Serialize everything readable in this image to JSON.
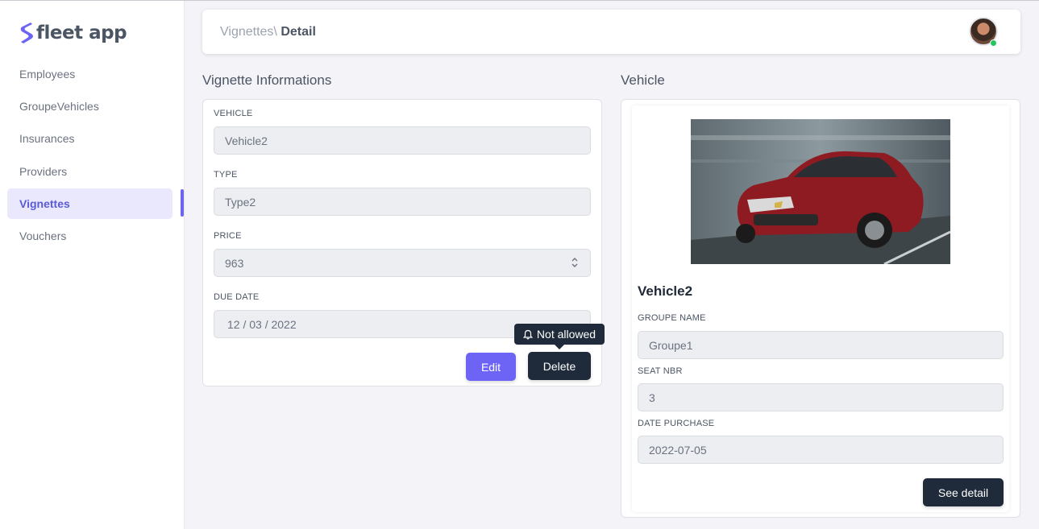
{
  "app": {
    "name": "fleet app"
  },
  "sidebar": {
    "items": [
      {
        "label": "Employees",
        "active": false
      },
      {
        "label": "GroupeVehicles",
        "active": false
      },
      {
        "label": "Insurances",
        "active": false
      },
      {
        "label": "Providers",
        "active": false
      },
      {
        "label": "Vignettes",
        "active": true
      },
      {
        "label": "Vouchers",
        "active": false
      }
    ]
  },
  "header": {
    "breadcrumb_parent": "Vignettes\\",
    "breadcrumb_current": "Detail"
  },
  "vignette": {
    "section_title": "Vignette Informations",
    "fields": {
      "vehicle": {
        "label": "VEHICLE",
        "value": "Vehicle2"
      },
      "type": {
        "label": "TYPE",
        "value": "Type2"
      },
      "price": {
        "label": "PRICE",
        "value": "963"
      },
      "due_date": {
        "label": "DUE DATE",
        "value": "12 / 03 / 2022"
      }
    },
    "edit_label": "Edit",
    "delete_label": "Delete",
    "tooltip": "Not allowed"
  },
  "vehicle": {
    "section_title": "Vehicle",
    "name": "Vehicle2",
    "fields": {
      "groupe_name": {
        "label": "GROUPE NAME",
        "value": "Groupe1"
      },
      "seat_nbr": {
        "label": "SEAT NBR",
        "value": "3"
      },
      "date_purchase": {
        "label": "DATE PURCHASE",
        "value": "2022-07-05"
      }
    },
    "see_detail_label": "See detail"
  },
  "colors": {
    "accent": "#6d64f5",
    "dark_button": "#1f2a3a",
    "active_nav_bg": "#e9e8fd",
    "online": "#22c55e"
  }
}
